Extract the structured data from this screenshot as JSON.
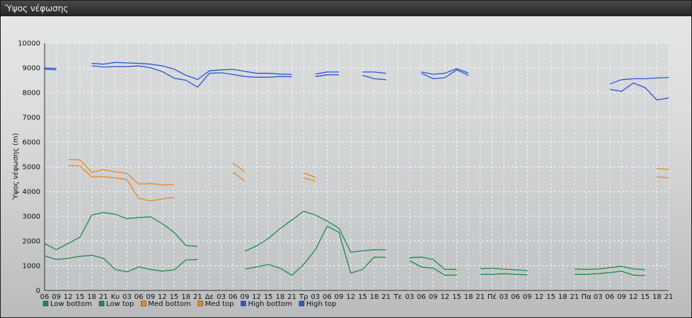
{
  "window": {
    "title": "Ύψος νέφωσης"
  },
  "chart_data": {
    "type": "line",
    "ylabel": "Ύψος νέφωσης (m)",
    "ylim": [
      0,
      10000
    ],
    "yticks": [
      0,
      1000,
      2000,
      3000,
      4000,
      5000,
      6000,
      7000,
      8000,
      9000,
      10000
    ],
    "grid": true,
    "legend_position": "bottom-left",
    "x": [
      "06",
      "09",
      "12",
      "15",
      "18",
      "21",
      "Κυ",
      "03",
      "06",
      "09",
      "12",
      "15",
      "18",
      "21",
      "Δε",
      "03",
      "06",
      "09",
      "12",
      "15",
      "18",
      "21",
      "Τρ",
      "03",
      "06",
      "09",
      "12",
      "15",
      "18",
      "21",
      "Τε",
      "03",
      "06",
      "09",
      "12",
      "15",
      "18",
      "21",
      "Πέ",
      "03",
      "06",
      "09",
      "12",
      "15",
      "18",
      "21",
      "Πα",
      "03",
      "06",
      "09",
      "12",
      "15",
      "18",
      "21"
    ],
    "series": [
      {
        "name": "Low bottom",
        "color": "#1f8a4c",
        "values": [
          1400,
          1250,
          1300,
          1380,
          1420,
          1300,
          850,
          750,
          950,
          850,
          780,
          830,
          1230,
          1250,
          null,
          null,
          null,
          870,
          950,
          1050,
          900,
          620,
          1050,
          1650,
          2600,
          2350,
          700,
          850,
          1350,
          1330,
          null,
          1200,
          950,
          900,
          620,
          620,
          null,
          650,
          650,
          680,
          650,
          630,
          null,
          null,
          null,
          650,
          650,
          680,
          720,
          780,
          620,
          600,
          null,
          null
        ]
      },
      {
        "name": "Low top",
        "color": "#1f8a4c",
        "values": [
          1900,
          1650,
          1900,
          2150,
          3050,
          3150,
          3080,
          2900,
          2950,
          2980,
          2700,
          2350,
          1820,
          1780,
          null,
          null,
          null,
          1580,
          1800,
          2100,
          2500,
          2850,
          3200,
          3050,
          2800,
          2520,
          1550,
          1600,
          1650,
          1640,
          null,
          1320,
          1350,
          1250,
          850,
          850,
          null,
          880,
          900,
          860,
          830,
          800,
          null,
          null,
          null,
          870,
          850,
          870,
          920,
          980,
          870,
          840,
          null,
          null
        ]
      },
      {
        "name": "Med bottom",
        "color": "#e8891c",
        "values": [
          null,
          null,
          5050,
          5030,
          4600,
          4600,
          4550,
          4480,
          3720,
          3620,
          3700,
          3760,
          null,
          null,
          null,
          null,
          4780,
          4430,
          null,
          null,
          null,
          null,
          4550,
          4420,
          null,
          null,
          null,
          null,
          null,
          null,
          null,
          null,
          null,
          null,
          null,
          null,
          null,
          null,
          null,
          null,
          null,
          null,
          null,
          null,
          null,
          null,
          null,
          null,
          null,
          null,
          null,
          null,
          4600,
          4550
        ]
      },
      {
        "name": "Med top",
        "color": "#e8891c",
        "values": [
          null,
          null,
          5300,
          5280,
          4780,
          4880,
          4800,
          4730,
          4300,
          4320,
          4270,
          4280,
          null,
          null,
          null,
          null,
          5150,
          4800,
          null,
          null,
          null,
          null,
          4750,
          4580,
          null,
          null,
          null,
          null,
          null,
          null,
          null,
          null,
          null,
          null,
          null,
          null,
          null,
          null,
          null,
          null,
          null,
          null,
          null,
          null,
          null,
          null,
          null,
          null,
          null,
          null,
          null,
          null,
          4930,
          4890
        ]
      },
      {
        "name": "High bottom",
        "color": "#2a56d4",
        "values": [
          8950,
          8920,
          null,
          null,
          9080,
          9030,
          9050,
          9050,
          9080,
          9000,
          8850,
          8580,
          8500,
          8220,
          8780,
          8800,
          8730,
          8650,
          8620,
          8620,
          8650,
          8640,
          null,
          8650,
          8720,
          8720,
          null,
          8700,
          8560,
          8520,
          null,
          null,
          8780,
          8560,
          8600,
          8920,
          8700,
          null,
          null,
          null,
          null,
          null,
          null,
          null,
          null,
          null,
          null,
          null,
          8130,
          8050,
          8390,
          8200,
          7700,
          7780
        ]
      },
      {
        "name": "High top",
        "color": "#2a56d4",
        "values": [
          8990,
          8980,
          null,
          null,
          9180,
          9150,
          9220,
          9200,
          9180,
          9150,
          9080,
          8950,
          8700,
          8530,
          8880,
          8920,
          8940,
          8860,
          8780,
          8780,
          8750,
          8730,
          null,
          8750,
          8830,
          8830,
          null,
          8830,
          8830,
          8780,
          null,
          null,
          8830,
          8740,
          8780,
          8970,
          8790,
          null,
          null,
          null,
          null,
          null,
          null,
          null,
          null,
          null,
          null,
          null,
          8350,
          8520,
          8560,
          8560,
          8590,
          8610
        ]
      }
    ]
  }
}
